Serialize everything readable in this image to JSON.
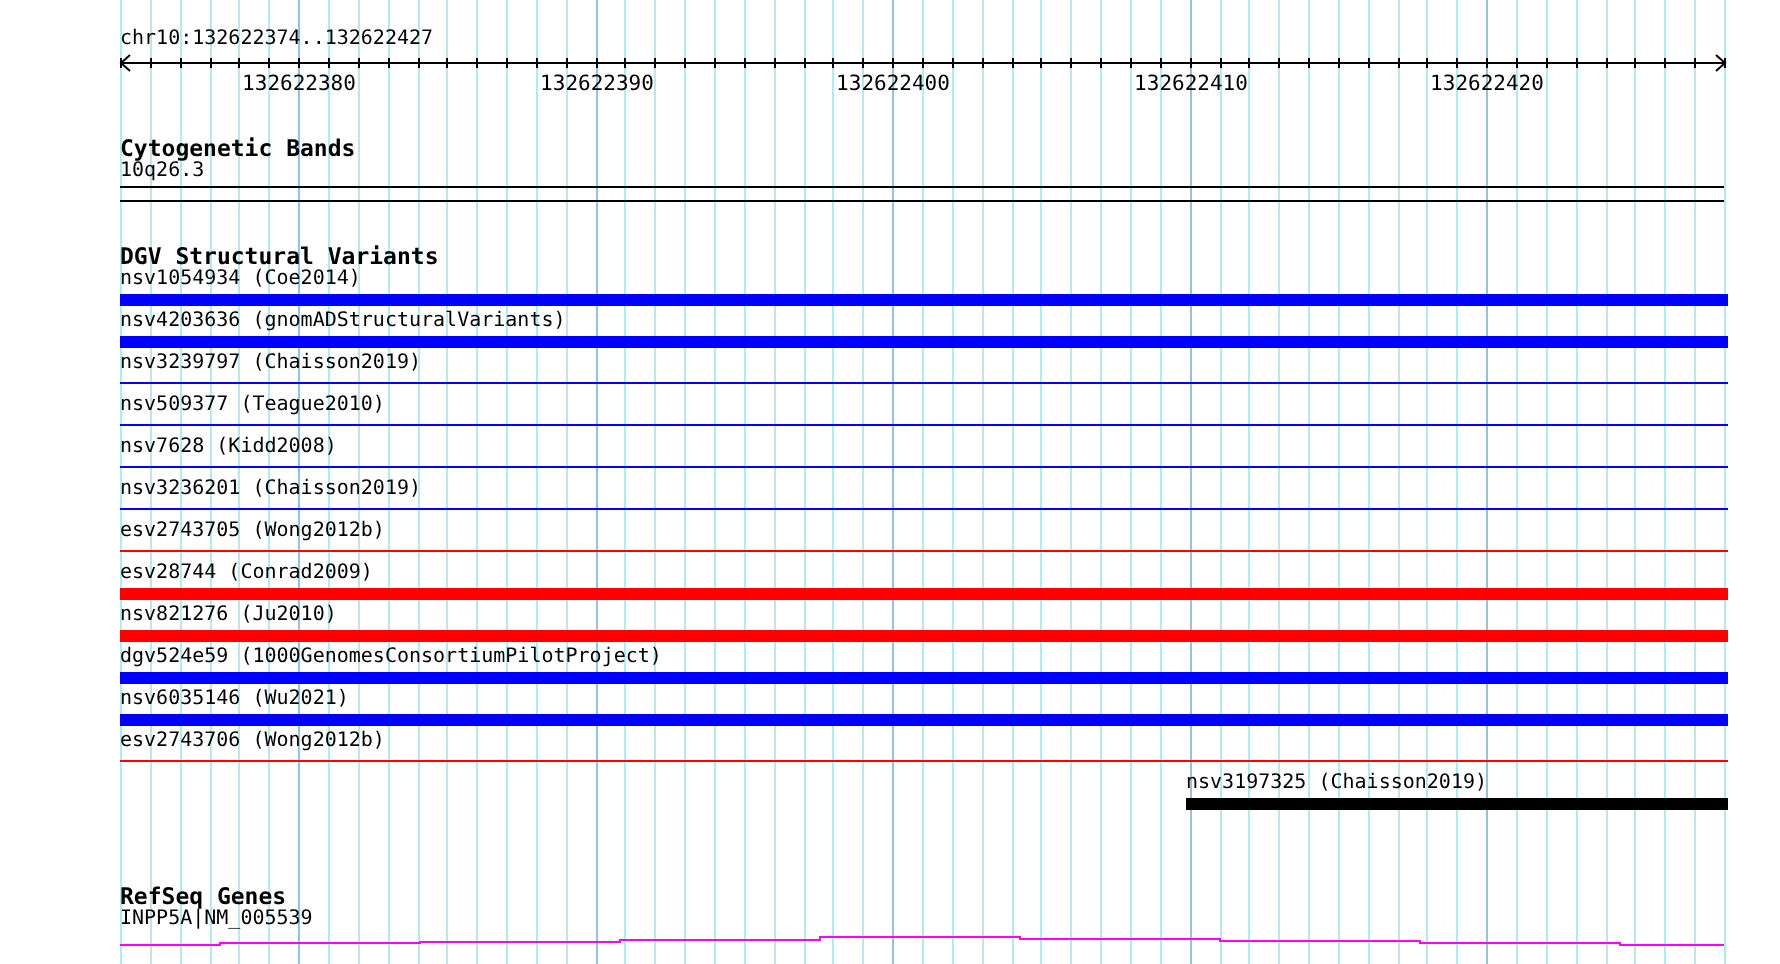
{
  "ruler": {
    "range": "chr10:132622374..132622427",
    "ticks": [
      "132622380",
      "132622390",
      "132622400",
      "132622410",
      "132622420"
    ]
  },
  "tracks": [
    {
      "kind": "bands",
      "title": "Cytogenetic Bands",
      "features": [
        {
          "label": "10q26.3"
        }
      ]
    },
    {
      "kind": "variants",
      "title": "DGV Structural Variants",
      "features": [
        {
          "label": "nsv1054934 (Coe2014)",
          "color": "#0000ff",
          "kind": "thick"
        },
        {
          "label": "nsv4203636 (gnomADStructuralVariants)",
          "color": "#0000ff",
          "kind": "thick"
        },
        {
          "label": "nsv3239797 (Chaisson2019)",
          "color": "#0000ff",
          "kind": "thin"
        },
        {
          "label": "nsv509377 (Teague2010)",
          "color": "#0000ff",
          "kind": "thin"
        },
        {
          "label": "nsv7628 (Kidd2008)",
          "color": "#0000ff",
          "kind": "thin"
        },
        {
          "label": "nsv3236201 (Chaisson2019)",
          "color": "#0000ff",
          "kind": "thin"
        },
        {
          "label": "esv2743705 (Wong2012b)",
          "color": "#ff0000",
          "kind": "thin"
        },
        {
          "label": "esv28744 (Conrad2009)",
          "color": "#ff0000",
          "kind": "thick"
        },
        {
          "label": "nsv821276 (Ju2010)",
          "color": "#ff0000",
          "kind": "thick"
        },
        {
          "label": "dgv524e59 (1000GenomesConsortiumPilotProject)",
          "color": "#0000ff",
          "kind": "thick"
        },
        {
          "label": "nsv6035146 (Wu2021)",
          "color": "#0000ff",
          "kind": "thick"
        },
        {
          "label": "esv2743706 (Wong2012b)",
          "color": "#ff0000",
          "kind": "thin"
        },
        {
          "label": "nsv3197325 (Chaisson2019)",
          "color": "#000000",
          "kind": "partial"
        }
      ]
    },
    {
      "kind": "genes",
      "title": "RefSeq Genes",
      "features": [
        {
          "label": "INPP5A|NM_005539"
        }
      ]
    }
  ]
}
